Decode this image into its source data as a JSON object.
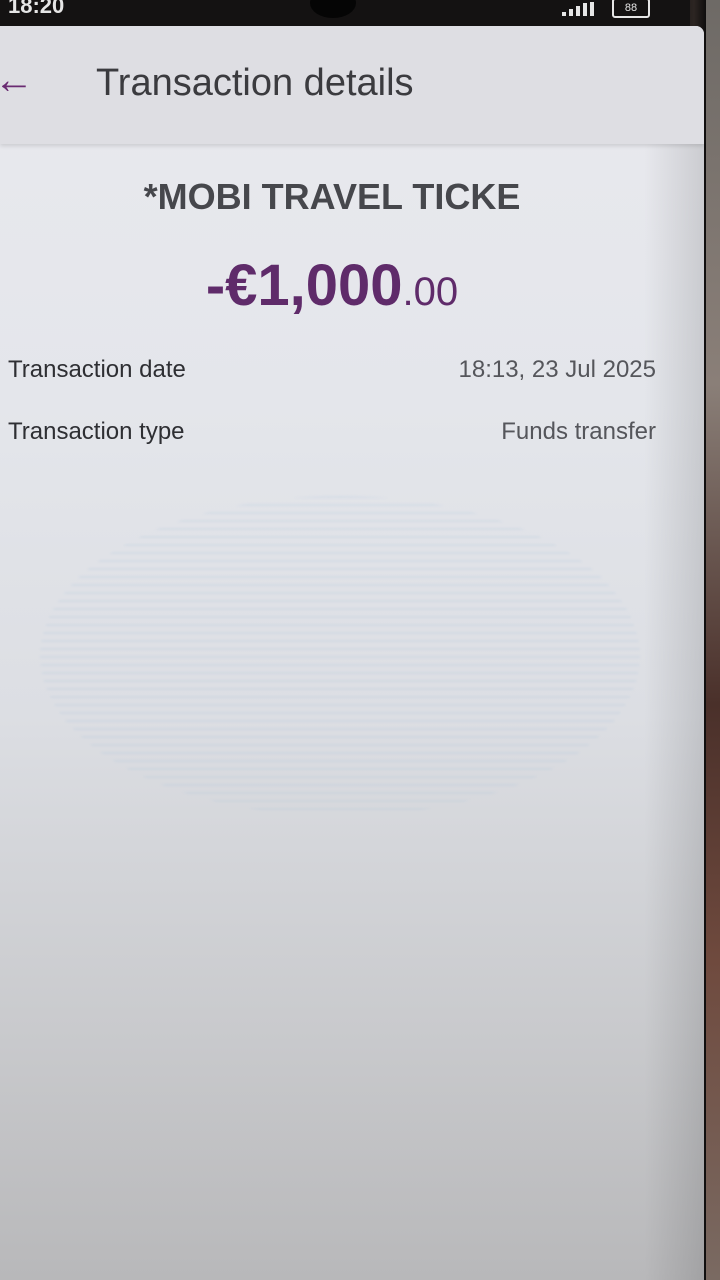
{
  "status_bar": {
    "time": "18:20",
    "battery": "88"
  },
  "header": {
    "back_icon": "back-arrow-icon",
    "title": "Transaction details"
  },
  "transaction": {
    "merchant": "*MOBI TRAVEL TICKE",
    "amount_main": "-€1,000",
    "amount_decimals": ".00",
    "amount_color": "#5f2b6a"
  },
  "details": [
    {
      "label": "Transaction date",
      "value": "18:13, 23 Jul 2025"
    },
    {
      "label": "Transaction type",
      "value": "Funds transfer"
    }
  ]
}
